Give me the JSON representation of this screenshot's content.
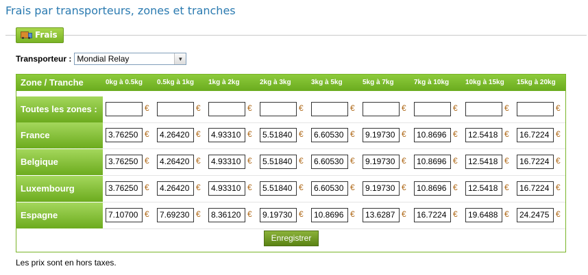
{
  "page": {
    "title": "Frais par transporteurs, zones et tranches",
    "footnote": "Les prix sont en hors taxes."
  },
  "fieldset": {
    "legend": "Frais",
    "legend_icon": "truck-icon"
  },
  "carrier": {
    "label": "Transporteur :",
    "selected": "Mondial Relay"
  },
  "table": {
    "zone_header": "Zone / Tranche",
    "brackets": [
      "0kg à 0.5kg",
      "0.5kg à 1kg",
      "1kg à 2kg",
      "2kg à 3kg",
      "3kg à 5kg",
      "5kg à 7kg",
      "7kg à 10kg",
      "10kg à 15kg",
      "15kg à 20kg"
    ],
    "currency": "€",
    "rows": [
      {
        "label": "Toutes les zones :",
        "values": [
          "",
          "",
          "",
          "",
          "",
          "",
          "",
          "",
          ""
        ]
      },
      {
        "label": "France",
        "values": [
          "3.76250",
          "4.26420",
          "4.93310",
          "5.51840",
          "6.60530",
          "9.19730",
          "10.8696",
          "12.5418",
          "16.7224"
        ]
      },
      {
        "label": "Belgique",
        "values": [
          "3.76250",
          "4.26420",
          "4.93310",
          "5.51840",
          "6.60530",
          "9.19730",
          "10.8696",
          "12.5418",
          "16.7224"
        ]
      },
      {
        "label": "Luxembourg",
        "values": [
          "3.76250",
          "4.26420",
          "4.93310",
          "5.51840",
          "6.60530",
          "9.19730",
          "10.8696",
          "12.5418",
          "16.7224"
        ]
      },
      {
        "label": "Espagne",
        "values": [
          "7.10700",
          "7.69230",
          "8.36120",
          "9.19730",
          "10.8696",
          "13.6287",
          "16.7224",
          "19.6488",
          "24.2475"
        ]
      }
    ],
    "save_label": "Enregistrer"
  },
  "colors": {
    "accent": "#78b325",
    "title": "#2a7ab0",
    "euro": "#b06a1a"
  }
}
